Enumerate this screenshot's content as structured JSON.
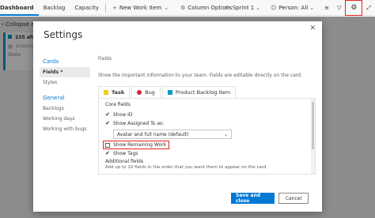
{
  "topbar": {
    "tabs": [
      {
        "label": "Dashboard"
      },
      {
        "label": "Backlog"
      },
      {
        "label": "Capacity"
      }
    ],
    "new_work_item": "New Work Item",
    "column_options": "Column Options",
    "sprint": "Sprint 1",
    "person": "Person: All"
  },
  "board": {
    "collapse_all": "Collapse all",
    "card": {
      "id": "235",
      "title_fragment": "afs",
      "assignee": "Unassign",
      "state": "State"
    }
  },
  "dialog": {
    "title": "Settings",
    "nav": {
      "cards_group": "Cards",
      "fields": "Fields *",
      "styles": "Styles",
      "general_group": "General",
      "backlogs": "Backlogs",
      "working_days": "Working days",
      "working_with_bugs": "Working with bugs"
    },
    "content": {
      "heading": "Fields",
      "description": "Show the important information to your team. Fields are editable directly on the card.",
      "tabs": [
        {
          "label": "Task",
          "color": "#f2cb1d"
        },
        {
          "label": "Bug",
          "color": "#cc293d"
        },
        {
          "label": "Product Backlog Item",
          "color": "#009ccc"
        }
      ],
      "core_fields": "Core fields",
      "show_id": "Show ID",
      "show_assigned_to": "Show Assigned To as:",
      "assigned_option": "Avatar and full name (default)",
      "show_remaining_work": "Show Remaining Work",
      "show_tags": "Show Tags",
      "additional_fields": "Additional fields",
      "additional_desc": "Add up to 10 fields in the order that you want them to appear on the card"
    },
    "save_label": "Save and close",
    "cancel_label": "Cancel"
  },
  "colors": {
    "accent": "#0078d4",
    "highlight": "#e02424"
  }
}
